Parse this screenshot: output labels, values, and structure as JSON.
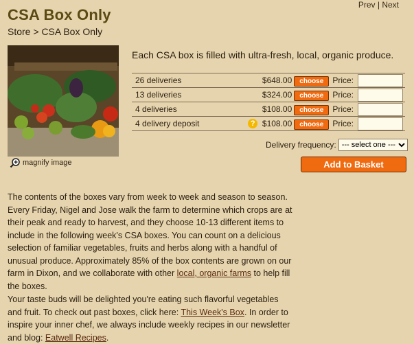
{
  "nav": {
    "prev": "Prev",
    "sep": "|",
    "next": "Next"
  },
  "title": "CSA Box Only",
  "breadcrumb": {
    "store": "Store",
    "sep": ">",
    "current": "CSA Box Only"
  },
  "image": {
    "magnify_label": "magnify image"
  },
  "intro": "Each CSA box is filled with ultra-fresh, local, organic produce.",
  "options": [
    {
      "label": "26 deliveries",
      "price": "$648.00",
      "button": "choose",
      "price_label": "Price:",
      "info": false
    },
    {
      "label": "13 deliveries",
      "price": "$324.00",
      "button": "choose",
      "price_label": "Price:",
      "info": false
    },
    {
      "label": "4 deliveries",
      "price": "$108.00",
      "button": "choose",
      "price_label": "Price:",
      "info": false
    },
    {
      "label": "4 delivery deposit",
      "price": "$108.00",
      "button": "choose",
      "price_label": "Price:",
      "info": true
    }
  ],
  "info_glyph": "?",
  "frequency": {
    "label": "Delivery frequency:",
    "selected": "--- select one ---"
  },
  "add_to_basket": "Add to Basket",
  "paragraph1": {
    "text": "The contents of the boxes vary from week to week and season to season. Every Friday, Nigel and Jose walk the farm to determine which crops are at their peak and ready to harvest, and they choose 10-13 different items to include in the following week's CSA boxes. You can count on a delicious selection of familiar vegetables, fruits and herbs along with a handful of unusual produce. Approximately 85% of the box contents are grown on our farm in Dixon, and we collaborate with other",
    "link": "local, organic farms",
    "after": "to help fill the boxes."
  },
  "paragraph2": {
    "text1": "Your taste buds will be delighted you're eating such flavorful vegetables and fruit. To check out past boxes, click here:",
    "link1": "This Week's Box",
    "text2": ". In order to inspire your inner chef, we always include weekly recipes in our newsletter and blog:",
    "link2": "Eatwell Recipes",
    "text3": "."
  }
}
